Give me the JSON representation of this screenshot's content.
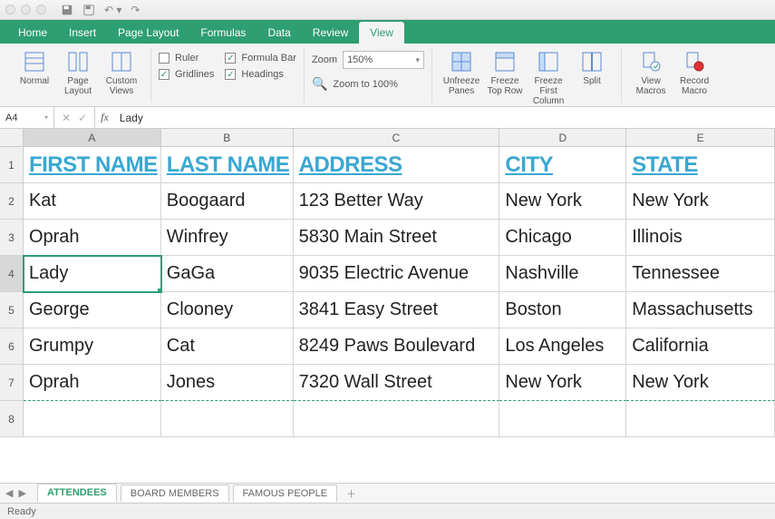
{
  "qat": {
    "icons": [
      "save",
      "disk",
      "undo",
      "redo"
    ]
  },
  "tabs": [
    "Home",
    "Insert",
    "Page Layout",
    "Formulas",
    "Data",
    "Review",
    "View"
  ],
  "active_tab": "View",
  "ribbon": {
    "views": [
      {
        "label": "Normal"
      },
      {
        "label": "Page Layout"
      },
      {
        "label": "Custom Views"
      }
    ],
    "show": {
      "ruler": {
        "label": "Ruler",
        "checked": false
      },
      "gridlines": {
        "label": "Gridlines",
        "checked": true
      },
      "formula_bar": {
        "label": "Formula Bar",
        "checked": true
      },
      "headings": {
        "label": "Headings",
        "checked": true
      }
    },
    "zoom_label": "Zoom",
    "zoom_value": "150%",
    "zoom100_label": "Zoom to 100%",
    "freeze": [
      {
        "label": "Unfreeze Panes"
      },
      {
        "label": "Freeze Top Row"
      },
      {
        "label": "Freeze First Column"
      },
      {
        "label": "Split"
      }
    ],
    "macros": [
      {
        "label": "View Macros"
      },
      {
        "label": "Record Macro"
      }
    ]
  },
  "namebox": "A4",
  "fx_label": "fx",
  "fx_value": "Lady",
  "columns": [
    "A",
    "B",
    "C",
    "D",
    "E"
  ],
  "col_widths": {
    "A": 152,
    "B": 146,
    "C": 228,
    "D": 140,
    "E": 164
  },
  "selected_cell": "A4",
  "headers": [
    "FIRST NAME",
    "LAST NAME",
    "ADDRESS",
    "CITY",
    "STATE"
  ],
  "rows": [
    [
      "Kat",
      "Boogaard",
      "123 Better Way",
      "New York",
      "New York"
    ],
    [
      "Oprah",
      "Winfrey",
      "5830 Main Street",
      "Chicago",
      "Illinois"
    ],
    [
      "Lady",
      "GaGa",
      "9035 Electric Avenue",
      "Nashville",
      "Tennessee"
    ],
    [
      "George",
      "Clooney",
      "3841 Easy Street",
      "Boston",
      "Massachusetts"
    ],
    [
      "Grumpy",
      "Cat",
      "8249 Paws Boulevard",
      "Los Angeles",
      "California"
    ],
    [
      "Oprah",
      "Jones",
      "7320 Wall Street",
      "New York",
      "New York"
    ]
  ],
  "row_numbers": [
    1,
    2,
    3,
    4,
    5,
    6,
    7,
    8
  ],
  "sheets": [
    "ATTENDEES",
    "BOARD MEMBERS",
    "FAMOUS PEOPLE"
  ],
  "active_sheet": "ATTENDEES",
  "status": "Ready"
}
